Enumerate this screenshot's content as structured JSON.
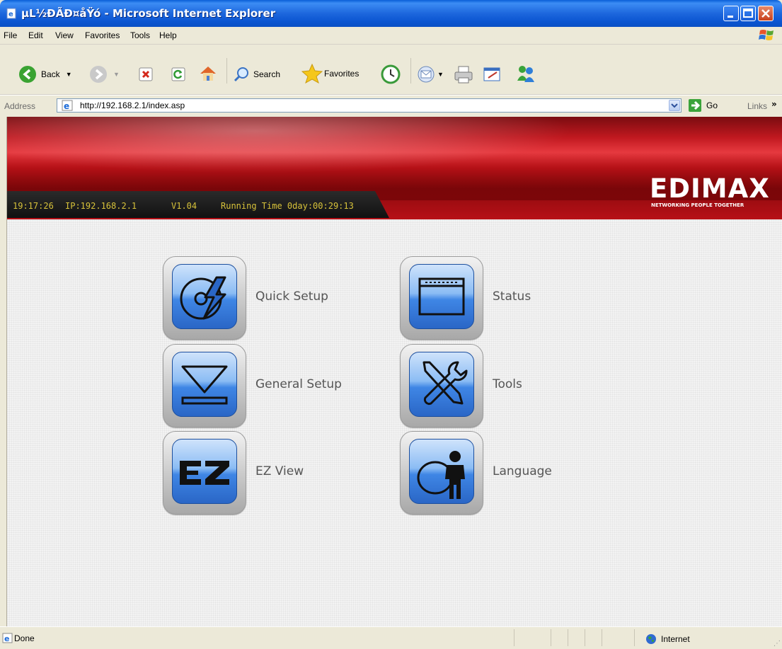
{
  "window": {
    "title": "µL½ÐÃÐ¤åŸó - Microsoft Internet Explorer"
  },
  "menu": {
    "items": [
      "File",
      "Edit",
      "View",
      "Favorites",
      "Tools",
      "Help"
    ]
  },
  "toolbar": {
    "back_label": "Back",
    "search_label": "Search",
    "favorites_label": "Favorites"
  },
  "address": {
    "label": "Address",
    "url": "http://192.168.2.1/index.asp",
    "go_label": "Go",
    "links_label": "Links"
  },
  "banner": {
    "time": "19:17:26",
    "ip": "IP:192.168.2.1",
    "version": "V1.04",
    "running_time": "Running Time 0day:00:29:13",
    "logo_text": "EDIMAX",
    "logo_tagline": "NETWORKING PEOPLE TOGETHER",
    "colors": {
      "banner_red": "#c0181f",
      "status_text": "#d7c23a"
    }
  },
  "tiles": {
    "quick_setup": "Quick Setup",
    "status": "Status",
    "general_setup": "General Setup",
    "tools": "Tools",
    "ez_view": "EZ View",
    "language": "Language"
  },
  "statusbar": {
    "done": "Done",
    "zone": "Internet"
  }
}
